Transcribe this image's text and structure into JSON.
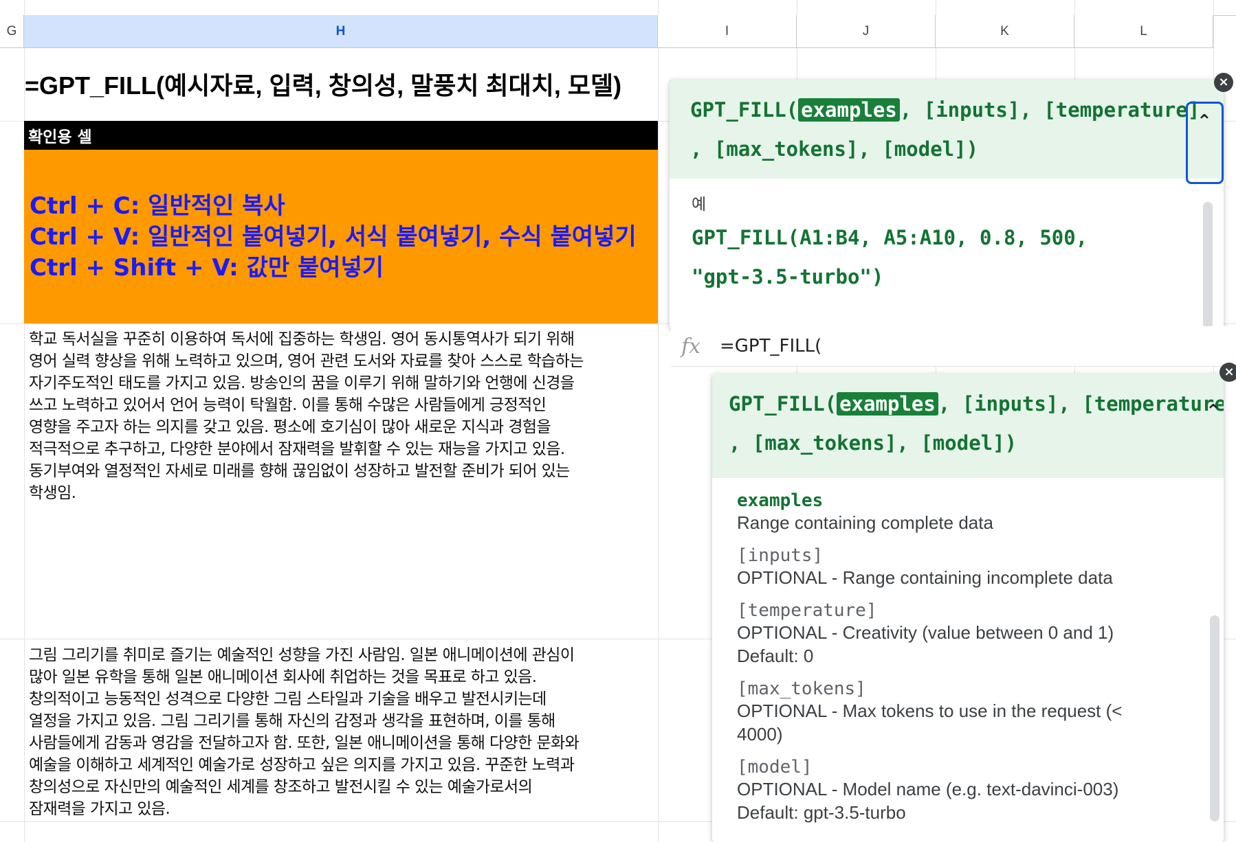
{
  "columns": [
    {
      "id": "G",
      "label": "G"
    },
    {
      "id": "H",
      "label": "H",
      "selected": true
    },
    {
      "id": "I",
      "label": "I"
    },
    {
      "id": "J",
      "label": "J"
    },
    {
      "id": "K",
      "label": "K"
    },
    {
      "id": "L",
      "label": "L"
    }
  ],
  "cells": {
    "formula_title": "=GPT_FILL(예시자료, 입력, 창의성, 말풍치 최대치, 모델)",
    "check_label": "확인용 셀",
    "shortcuts": [
      "Ctrl + C: 일반적인 복사",
      "Ctrl + V: 일반적인 붙여넣기, 서식 붙여넣기, 수식 붙여넣기",
      "Ctrl + Shift + V: 값만 붙여넣기"
    ],
    "text1": [
      "학교 독서실을 꾸준히 이용하여 독서에 집중하는 학생임. 영어 동시통역사가 되기 위해",
      "영어 실력 향상을 위해 노력하고 있으며, 영어 관련 도서와 자료를 찾아 스스로 학습하는",
      "자기주도적인 태도를 가지고 있음. 방송인의 꿈을 이루기 위해 말하기와 언행에 신경을",
      "쓰고 노력하고 있어서 언어 능력이 탁월함. 이를 통해 수많은 사람들에게 긍정적인",
      "영향을 주고자 하는 의지를 갖고 있음. 평소에 호기심이 많아 새로운 지식과 경험을",
      "적극적으로 추구하고, 다양한 분야에서 잠재력을 발휘할 수 있는 재능을 가지고 있음.",
      "동기부여와 열정적인 자세로 미래를 향해 끊임없이 성장하고 발전할 준비가 되어 있는",
      "학생임."
    ],
    "text2": [
      "그림 그리기를 취미로 즐기는 예술적인 성향을 가진 사람임. 일본 애니메이션에 관심이",
      "많아 일본 유학을 통해 일본 애니메이션 회사에 취업하는 것을 목표로 하고 있음.",
      "창의적이고 능동적인 성격으로 다양한 그림 스타일과 기술을 배우고 발전시키는데",
      "열정을 가지고 있음. 그림 그리기를 통해 자신의 감정과 생각을 표현하며, 이를 통해",
      "사람들에게 감동과 영감을 전달하고자 함. 또한, 일본 애니메이션을 통해 다양한 문화와",
      "예술을 이해하고 세계적인 예술가로 성장하고 싶은 의지를 가지고 있음. 꾸준한 노력과",
      "창의성으로 자신만의 예술적인 세계를 창조하고 발전시킬 수 있는 예술가로서의",
      "잠재력을 가지고 있음."
    ]
  },
  "popup1": {
    "close_icon": "×",
    "sig_prefix": "GPT_FILL(",
    "sig_highlight": "examples",
    "sig_rest1": ", [inputs], [temperature]",
    "sig_rest2": ", [max_tokens], [model])",
    "chevron": "⌃",
    "example_label": "예",
    "example_line1": "GPT_FILL(A1:B4, A5:A10, 0.8, 500,",
    "example_line2": "\"gpt-3.5-turbo\")"
  },
  "formula_bar": {
    "fx_icon": "fx",
    "text": "=GPT_FILL("
  },
  "popup2": {
    "close_icon": "×",
    "sig_prefix": "GPT_FILL(",
    "sig_highlight": "examples",
    "sig_rest1": ", [inputs], [temperature]",
    "sig_rest2": ", [max_tokens], [model])",
    "chevron": "⌃",
    "params": [
      {
        "name": "examples",
        "desc": "Range containing complete data",
        "required": true
      },
      {
        "name": "[inputs]",
        "desc": "OPTIONAL - Range containing incomplete data",
        "required": false
      },
      {
        "name": "[temperature]",
        "desc": "OPTIONAL - Creativity (value between 0 and 1) Default: 0",
        "required": false
      },
      {
        "name": "[max_tokens]",
        "desc": "OPTIONAL - Max tokens to use in the request (< 4000)",
        "required": false
      },
      {
        "name": "[model]",
        "desc": "OPTIONAL - Model name (e.g. text-davinci-003) Default: gpt-3.5-turbo",
        "required": false
      }
    ]
  }
}
